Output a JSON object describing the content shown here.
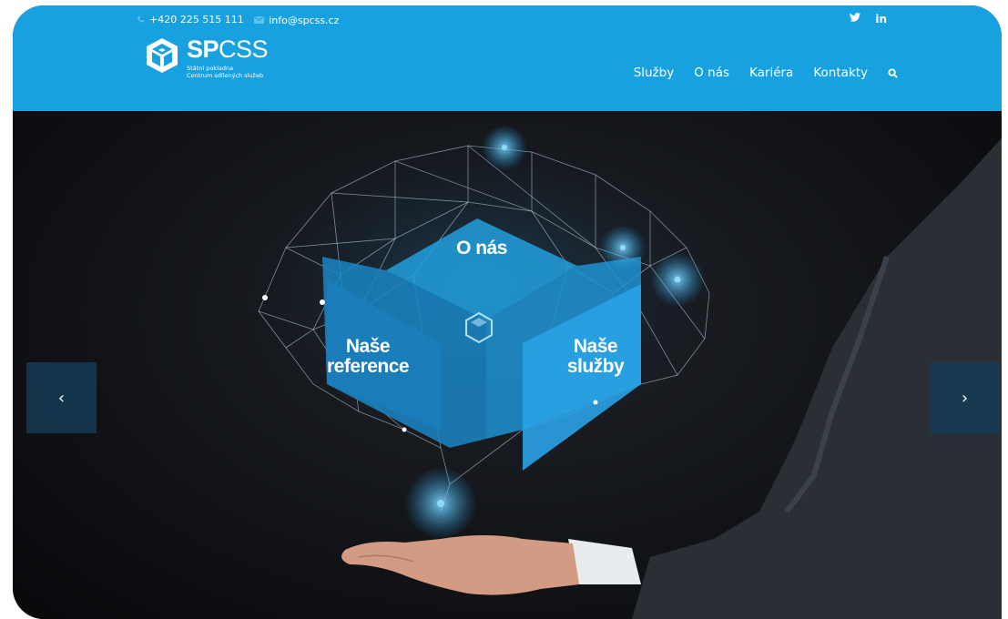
{
  "topbar": {
    "phone": "+420 225 515 111",
    "email": "info@spcss.cz"
  },
  "social": {
    "twitter": "twitter-icon",
    "linkedin": "in"
  },
  "logo": {
    "bold": "SP",
    "regular": "CSS",
    "line1": "Státní pokladna",
    "line2": "Centrum sdílených služeb"
  },
  "nav": {
    "items": [
      "Služby",
      "O nás",
      "Kariéra",
      "Kontakty"
    ],
    "search": "search-icon"
  },
  "hero": {
    "top_label": "O nás",
    "left_line1": "Naše",
    "left_line2": "reference",
    "right_line1": "Naše",
    "right_line2": "služby",
    "prev": "‹",
    "next": "›"
  },
  "colors": {
    "brand_blue": "#18a1e0",
    "cube_blue": "#1f8fcf"
  }
}
